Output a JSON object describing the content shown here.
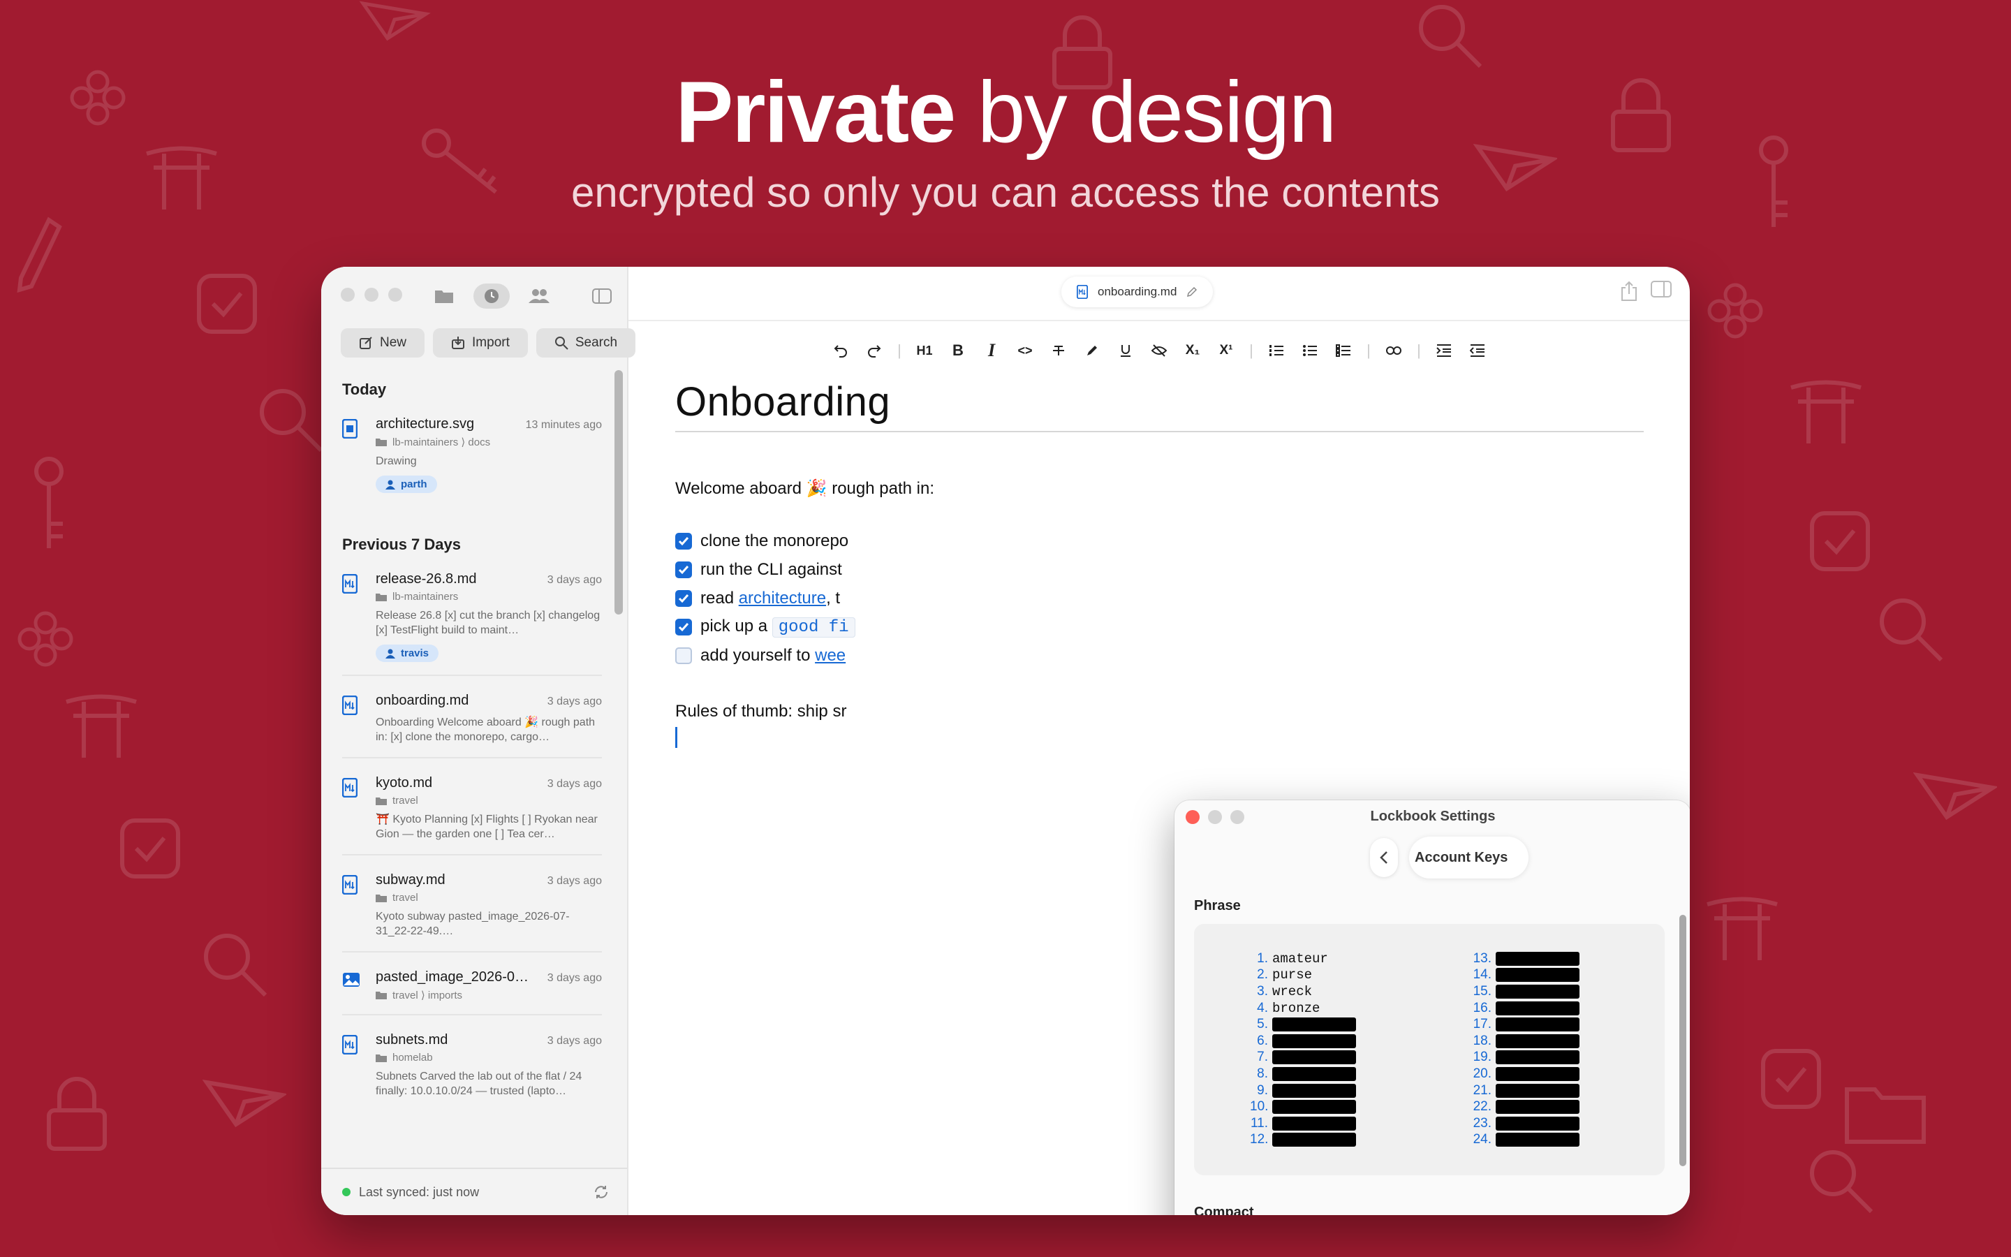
{
  "hero": {
    "title_strong": "Private",
    "title_rest": "by design",
    "subtitle": "encrypted so only you can access the contents"
  },
  "sidebar": {
    "actions": {
      "new": "New",
      "import": "Import",
      "search": "Search"
    },
    "sections": [
      {
        "title": "Today",
        "files": [
          {
            "name": "architecture.svg",
            "time": "13 minutes ago",
            "path": "lb-maintainers ⟩ docs",
            "preview": "Drawing",
            "tag": "parth",
            "icon": "file-drawing-icon"
          }
        ]
      },
      {
        "title": "Previous 7 Days",
        "files": [
          {
            "name": "release-26.8.md",
            "time": "3 days ago",
            "path": "lb-maintainers",
            "preview": "Release 26.8 [x] cut the branch [x] changelog [x] TestFlight build to maint…",
            "tag": "travis",
            "icon": "file-markdown-icon"
          },
          {
            "name": "onboarding.md",
            "time": "3 days ago",
            "path": "",
            "preview": "Onboarding Welcome aboard 🎉 rough path in: [x] clone the monorepo, cargo…",
            "tag": "",
            "icon": "file-markdown-icon"
          },
          {
            "name": "kyoto.md",
            "time": "3 days ago",
            "path": "travel",
            "preview": "⛩️ Kyoto Planning [x] Flights [ ] Ryokan near Gion — the garden one [ ] Tea cer…",
            "tag": "",
            "icon": "file-markdown-icon"
          },
          {
            "name": "subway.md",
            "time": "3 days ago",
            "path": "travel",
            "preview": "Kyoto subway pasted_image_2026-07-31_22-22-49.…",
            "tag": "",
            "icon": "file-markdown-icon"
          },
          {
            "name": "pasted_image_2026-0…",
            "time": "3 days ago",
            "path": "travel ⟩ imports",
            "preview": "",
            "tag": "",
            "icon": "file-image-icon"
          },
          {
            "name": "subnets.md",
            "time": "3 days ago",
            "path": "homelab",
            "preview": "Subnets Carved the lab out of the flat / 24 finally: 10.0.10.0/24 — trusted (lapto…",
            "tag": "",
            "icon": "file-markdown-icon"
          }
        ]
      }
    ],
    "footer": "Last synced: just now"
  },
  "editor": {
    "tab_name": "onboarding.md",
    "toolbar": {
      "h1": "H1",
      "bold": "B",
      "italic": "I",
      "code": "<>",
      "sub": "X₁",
      "sup": "X¹"
    },
    "title": "Onboarding",
    "welcome": "Welcome aboard 🎉 rough path in:",
    "checklist": [
      {
        "checked": true,
        "pre": "clone the monorepo",
        "link": "",
        "code": ""
      },
      {
        "checked": true,
        "pre": "run the CLI against",
        "link": "",
        "code": ""
      },
      {
        "checked": true,
        "pre": "read ",
        "link": "architecture",
        "post": ", t",
        "code": ""
      },
      {
        "checked": true,
        "pre": "pick up a ",
        "link": "",
        "code": "good fi"
      },
      {
        "checked": false,
        "pre": "add yourself to ",
        "link": "wee",
        "code": ""
      }
    ],
    "rules": "Rules of thumb: ship sr"
  },
  "dialog": {
    "title": "Lockbook Settings",
    "page": "Account Keys",
    "phrase_label": "Phrase",
    "words": [
      "amateur",
      "purse",
      "wreck",
      "bronze"
    ],
    "left_numbers": [
      "1.",
      "2.",
      "3.",
      "4.",
      "5.",
      "6.",
      "7.",
      "8.",
      "9.",
      "10.",
      "11.",
      "12."
    ],
    "right_numbers": [
      "13.",
      "14.",
      "15.",
      "16.",
      "17.",
      "18.",
      "19.",
      "20.",
      "21.",
      "22.",
      "23.",
      "24."
    ],
    "compact_label": "Compact"
  },
  "colors": {
    "background": "#a11b30",
    "accent": "#1769d4",
    "close": "#fe5f57",
    "sync": "#34c759"
  }
}
